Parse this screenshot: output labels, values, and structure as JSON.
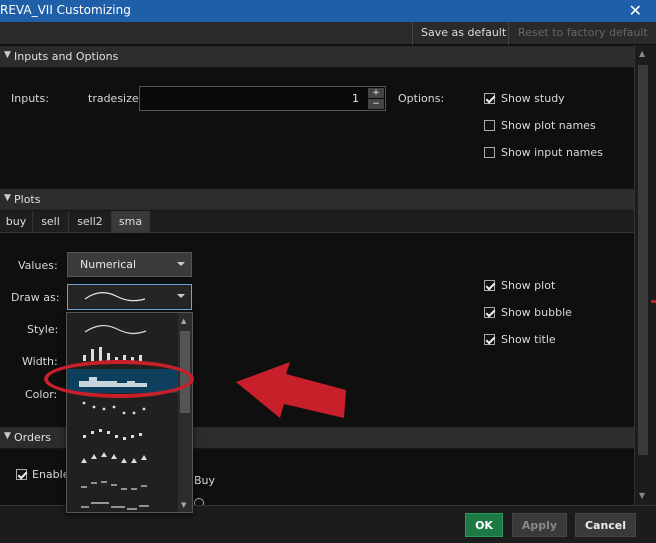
{
  "window": {
    "title": "REVA_VII Customizing",
    "close_glyph": "✕"
  },
  "toolbar": {
    "save_default": "Save as default",
    "reset_factory": "Reset to factory default"
  },
  "sections": {
    "inputs": {
      "header": "Inputs and Options"
    },
    "plots": {
      "header": "Plots"
    },
    "orders": {
      "header": "Orders"
    }
  },
  "inputs": {
    "label": "Inputs:",
    "param_name": "tradesize",
    "param_value": "1",
    "options_label": "Options:"
  },
  "options": [
    {
      "label": "Show study",
      "checked": true
    },
    {
      "label": "Show plot names",
      "checked": false
    },
    {
      "label": "Show input names",
      "checked": false
    }
  ],
  "plot_tabs": [
    {
      "label": "buy",
      "active": false
    },
    {
      "label": "sell",
      "active": false
    },
    {
      "label": "sell2",
      "active": false
    },
    {
      "label": "sma",
      "active": true
    }
  ],
  "plot_settings": {
    "values_label": "Values:",
    "values_value": "Numerical",
    "draw_as_label": "Draw as:",
    "style_label": "Style:",
    "width_label": "Width:",
    "color_label": "Color:"
  },
  "plot_options": [
    {
      "label": "Show plot",
      "checked": true
    },
    {
      "label": "Show bubble",
      "checked": true
    },
    {
      "label": "Show title",
      "checked": true
    }
  ],
  "draw_as_options": [
    {
      "icon": "line-curve-icon",
      "selected": false
    },
    {
      "icon": "histogram-icon",
      "selected": false
    },
    {
      "icon": "area-fill-icon",
      "selected": true
    },
    {
      "icon": "dots-icon",
      "selected": false
    },
    {
      "icon": "squares-icon",
      "selected": false
    },
    {
      "icon": "triangles-icon",
      "selected": false
    },
    {
      "icon": "dashes-icon",
      "selected": false
    },
    {
      "icon": "horizontal-steps-icon",
      "selected": false
    }
  ],
  "orders": {
    "enable_label": "Enable",
    "enable_checked": true,
    "side_label": "Buy"
  },
  "footer": {
    "ok": "OK",
    "apply": "Apply",
    "cancel": "Cancel"
  },
  "colors": {
    "title_bar": "#1f5fa8",
    "ok_button": "#1e7a45",
    "annotation_red": "#c8202a",
    "selected_row": "#0e3f5c"
  }
}
